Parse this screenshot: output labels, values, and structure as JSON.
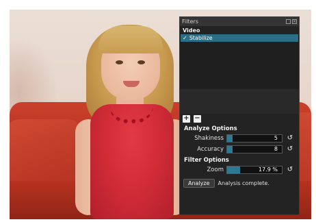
{
  "panel": {
    "title": "Filters",
    "title_icons": [
      "float-icon",
      "close-icon"
    ],
    "list_header": "Video",
    "items": [
      {
        "label": "Stabilize",
        "checked": true,
        "check_glyph": "✓"
      }
    ],
    "add_label": "+",
    "remove_label": "−"
  },
  "analyze_options": {
    "heading": "Analyze Options",
    "shakiness": {
      "label": "Shakiness",
      "value": "5",
      "fraction": 0.1
    },
    "accuracy": {
      "label": "Accuracy",
      "value": "8",
      "fraction": 0.1
    }
  },
  "filter_options": {
    "heading": "Filter Options",
    "zoom": {
      "label": "Zoom",
      "value": "17.9 %",
      "fraction": 0.24
    }
  },
  "analyze": {
    "button_label": "Analyze",
    "status": "Analysis complete."
  },
  "colors": {
    "panel_bg": "#232323",
    "accent": "#2b6f86",
    "slider_fill": "#2d7a96"
  }
}
